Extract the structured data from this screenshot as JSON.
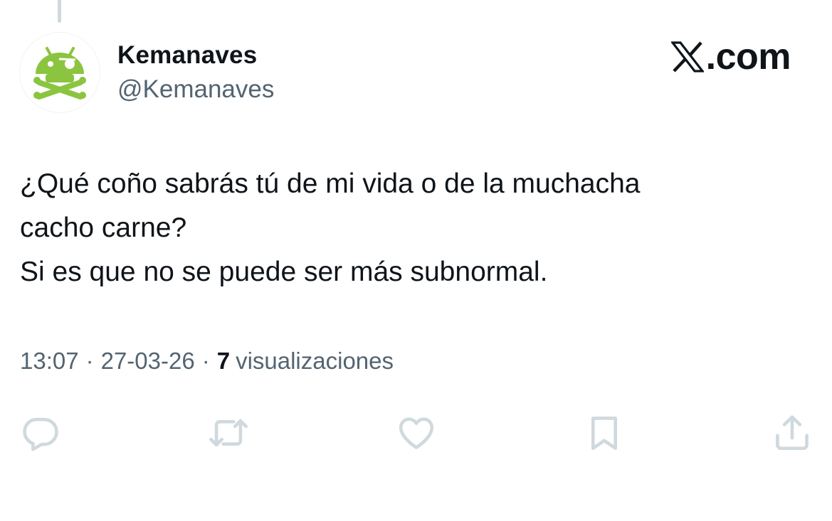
{
  "author": {
    "display_name": "Kemanaves",
    "handle": "@Kemanaves",
    "avatar_icon": "android-skull-crossbones-icon",
    "avatar_color": "#8bc43f"
  },
  "brand": {
    "text": ".com",
    "icon": "x-logo-icon"
  },
  "tweet": {
    "lines": [
      "¿Qué coño sabrás tú de mi vida o de la muchacha",
      "cacho carne?",
      "Si es que no se puede ser más subnormal."
    ]
  },
  "meta": {
    "time": "13:07",
    "separator": "·",
    "date": "27-03-26",
    "views_count": "7",
    "views_label": "visualizaciones"
  },
  "actions": [
    {
      "name": "reply",
      "icon": "reply-bubble-icon"
    },
    {
      "name": "repost",
      "icon": "repost-arrows-icon"
    },
    {
      "name": "like",
      "icon": "heart-icon"
    },
    {
      "name": "bookmark",
      "icon": "bookmark-icon"
    },
    {
      "name": "share",
      "icon": "share-upload-icon"
    }
  ],
  "colors": {
    "text_primary": "#0f1419",
    "text_secondary": "#536471",
    "action_icon": "#cfd9de",
    "background": "#ffffff"
  }
}
